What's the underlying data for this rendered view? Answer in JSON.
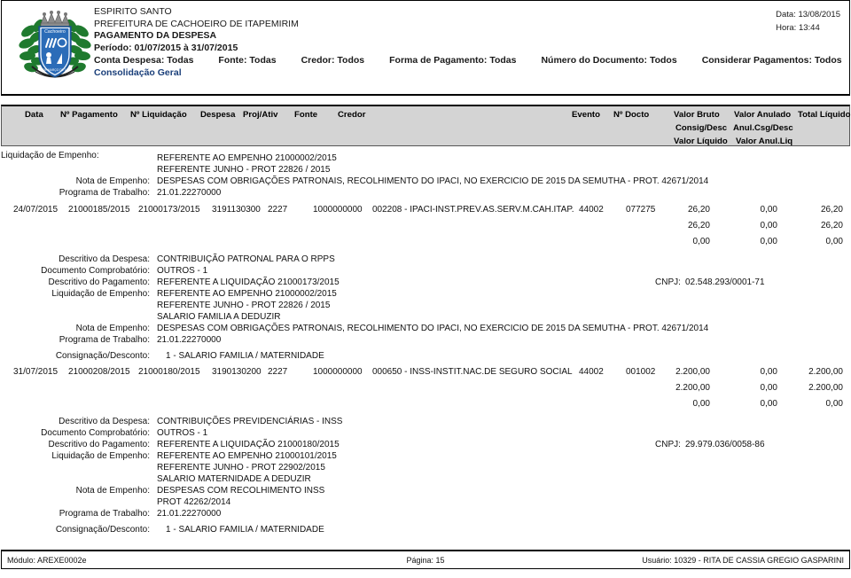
{
  "header": {
    "state": "ESPIRITO SANTO",
    "entity": "PREFEITURA DE CACHOEIRO DE ITAPEMIRIM",
    "report_title": "PAGAMENTO DA DESPESA",
    "period": "Período: 01/07/2015 à 31/07/2015",
    "filters": [
      "Conta Despesa: Todas",
      "Fonte: Todas",
      "Credor: Todos",
      "Forma de Pagamento: Todas",
      "Número do Documento: Todos",
      "Considerar Pagamentos: Todos"
    ],
    "consolidation": "Consolidação Geral",
    "date": "Data: 13/08/2015",
    "time": "Hora: 13:44"
  },
  "columns": {
    "row1": [
      "Data",
      "Nº Pagamento",
      "Nº Liquidação",
      "Despesa",
      "Proj/Ativ",
      "Fonte",
      "Credor",
      "Evento",
      "Nº Docto",
      "Valor Bruto",
      "Valor Anulado",
      "Total Líquido"
    ],
    "row2": [
      "Consig/Desc",
      "Anul.Csg/Desc"
    ],
    "row3": [
      "Valor Líquido",
      "Valor Anul.Liq"
    ]
  },
  "labels": {
    "liquidacao": "Liquidação de Empenho:",
    "nota": "Nota de Empenho:",
    "programa": "Programa de Trabalho:",
    "descritivo_despesa": "Descritivo da Despesa:",
    "documento": "Documento Comprobatório:",
    "descritivo_pagamento": "Descritivo do Pagamento:",
    "consignacao": "Consignação/Desconto:",
    "cnpj": "CNPJ:"
  },
  "entries": [
    {
      "pre": {
        "liquidacao_lines": [
          "REFERENTE AO EMPENHO 21000002/2015",
          "REFERENTE JUNHO - PROT 22826 / 2015"
        ],
        "nota_lines": [
          "DESPESAS COM OBRIGAÇÕES PATRONAIS, RECOLHIMENTO DO IPACI, NO EXERCICIO DE 2015 DA SEMUTHA - PROT. 42671/2014"
        ],
        "programa": "21.01.22270000"
      },
      "row": {
        "data": "24/07/2015",
        "n_pagamento": "21000185/2015",
        "n_liquidacao": "21000173/2015",
        "despesa": "3191130300",
        "proj_ativ": "2227",
        "fonte": "1000000000",
        "credor": "002208 - IPACI-INST.PREV.AS.SERV.M.CAH.ITAP.",
        "evento": "44002",
        "n_docto": "077275",
        "valor_bruto": "26,20",
        "valor_anulado": "0,00",
        "total_liquido": "26,20",
        "consig_desc": "26,20",
        "anul_csg_desc": "0,00",
        "total_liquido2": "26,20",
        "valor_liquido": "0,00",
        "valor_anul_liq": "0,00",
        "total_liquido3": "0,00"
      },
      "detail": {
        "descritivo_despesa": "CONTRIBUIÇÃO PATRONAL PARA O RPPS",
        "documento": "OUTROS - 1",
        "descritivo_pagamento": "REFERENTE A LIQUIDAÇÃO 21000173/2015",
        "cnpj": "02.548.293/0001-71",
        "liquidacao_lines": [
          "REFERENTE AO EMPENHO 21000002/2015",
          "REFERENTE JUNHO - PROT 22826 / 2015",
          "SALARIO FAMILIA A DEDUZIR"
        ],
        "nota_lines": [
          "DESPESAS COM OBRIGAÇÕES PATRONAIS, RECOLHIMENTO DO IPACI, NO EXERCICIO DE 2015 DA SEMUTHA - PROT. 42671/2014"
        ],
        "programa": "21.01.22270000",
        "consignacao": "1 - SALARIO FAMILIA / MATERNIDADE"
      }
    },
    {
      "row": {
        "data": "31/07/2015",
        "n_pagamento": "21000208/2015",
        "n_liquidacao": "21000180/2015",
        "despesa": "3190130200",
        "proj_ativ": "2227",
        "fonte": "1000000000",
        "credor": "000650 - INSS-INSTIT.NAC.DE SEGURO SOCIAL",
        "evento": "44002",
        "n_docto": "001002",
        "valor_bruto": "2.200,00",
        "valor_anulado": "0,00",
        "total_liquido": "2.200,00",
        "consig_desc": "2.200,00",
        "anul_csg_desc": "0,00",
        "total_liquido2": "2.200,00",
        "valor_liquido": "0,00",
        "valor_anul_liq": "0,00",
        "total_liquido3": "0,00"
      },
      "detail": {
        "descritivo_despesa": "CONTRIBUIÇÕES PREVIDENCIÁRIAS - INSS",
        "documento": "OUTROS - 1",
        "descritivo_pagamento": "REFERENTE A LIQUIDAÇÃO 21000180/2015",
        "cnpj": "29.979.036/0058-86",
        "liquidacao_lines": [
          "REFERENTE AO EMPENHO 21000101/2015",
          "REFERENTE JUNHO - PROT 22902/2015",
          "SALARIO MATERNIDADE A DEDUZIR"
        ],
        "nota_lines": [
          "DESPESAS COM RECOLHIMENTO INSS",
          "PROT 42262/2014"
        ],
        "programa": "21.01.22270000",
        "consignacao": "1 - SALARIO FAMILIA / MATERNIDADE"
      }
    }
  ],
  "footer": {
    "modulo": "Módulo: AREXE0002e",
    "pagina": "Página: 15",
    "usuario": "Usuário: 10329 - RITA DE CASSIA GREGIO GASPARINI"
  }
}
